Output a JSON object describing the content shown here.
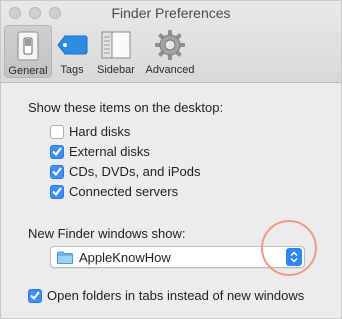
{
  "window": {
    "title": "Finder Preferences"
  },
  "toolbar": {
    "tabs": [
      {
        "label": "General",
        "icon": "general-switch-icon",
        "selected": true
      },
      {
        "label": "Tags",
        "icon": "tag-icon",
        "selected": false
      },
      {
        "label": "Sidebar",
        "icon": "sidebar-icon",
        "selected": false
      },
      {
        "label": "Advanced",
        "icon": "gear-icon",
        "selected": false
      }
    ]
  },
  "general": {
    "desktop_heading": "Show these items on the desktop:",
    "desktop_items": [
      {
        "label": "Hard disks",
        "checked": false
      },
      {
        "label": "External disks",
        "checked": true
      },
      {
        "label": "CDs, DVDs, and iPods",
        "checked": true
      },
      {
        "label": "Connected servers",
        "checked": true
      }
    ],
    "new_window_heading": "New Finder windows show:",
    "new_window_value": "AppleKnowHow",
    "tabs_option": {
      "label": "Open folders in tabs instead of new windows",
      "checked": true
    }
  },
  "colors": {
    "accent": "#3e8ef6",
    "annotation_ring": "#ef9a88"
  }
}
